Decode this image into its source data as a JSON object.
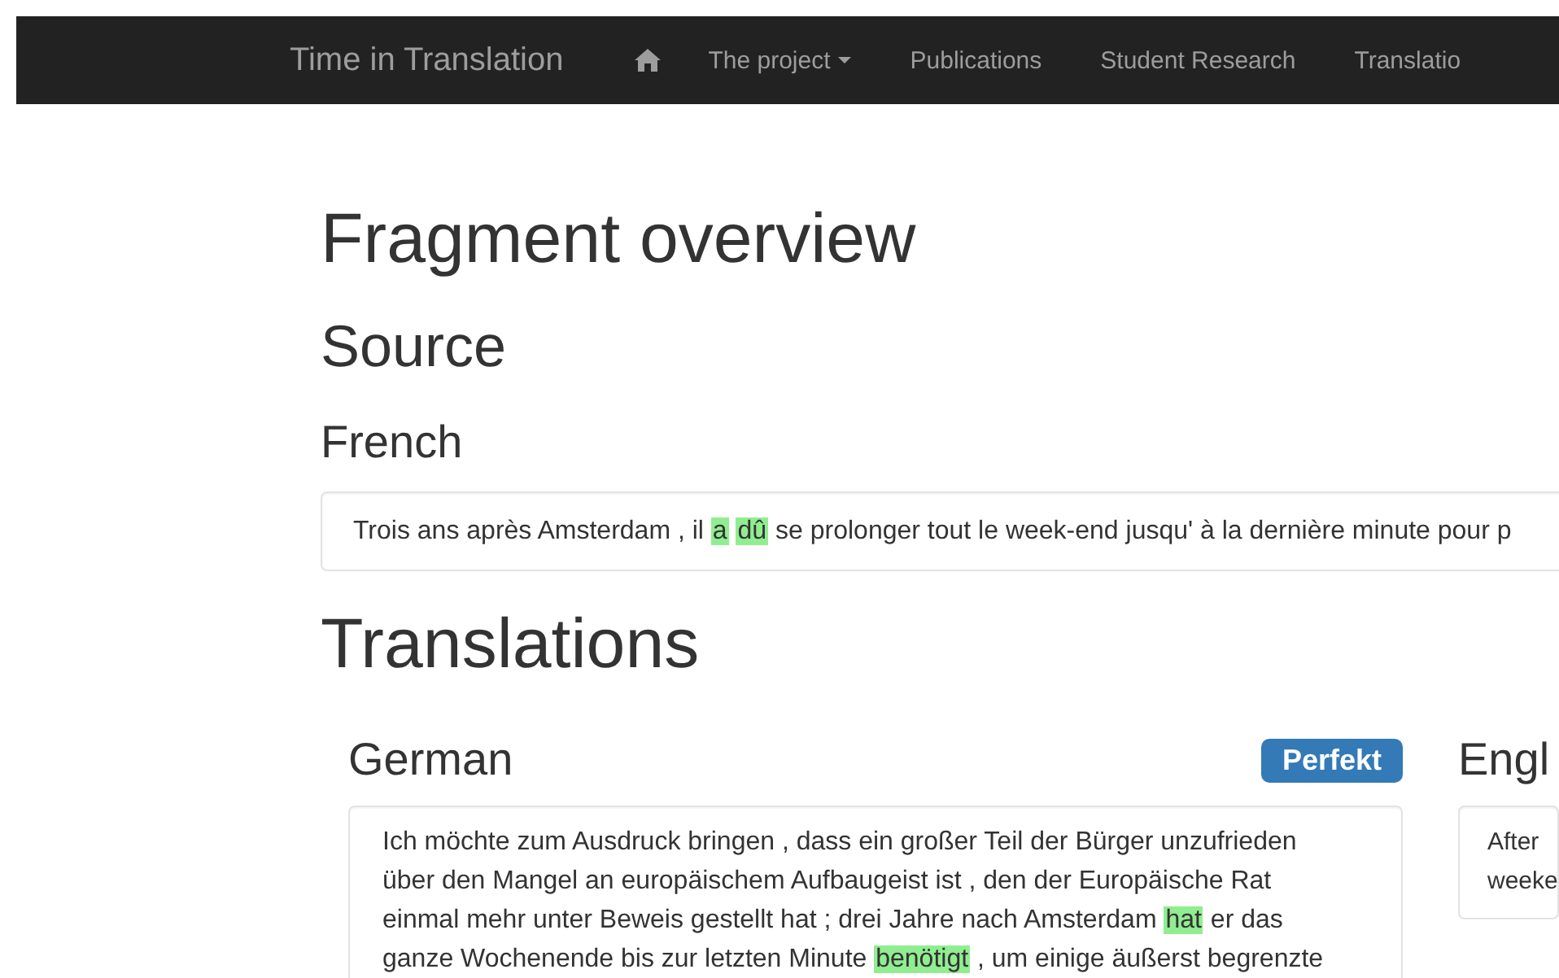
{
  "navbar": {
    "brand": "Time in Translation",
    "items": [
      {
        "label": "The project",
        "dropdown": true
      },
      {
        "label": "Publications",
        "dropdown": false
      },
      {
        "label": "Student Research",
        "dropdown": false
      },
      {
        "label": "Translatio",
        "dropdown": false
      }
    ]
  },
  "title": "Fragment overview",
  "source": {
    "heading": "Source",
    "language": "French",
    "segments": [
      {
        "text": "Trois ans après Amsterdam , il ",
        "highlighted": false
      },
      {
        "text": "a",
        "highlighted": true
      },
      {
        "text": "dû",
        "highlighted": true
      },
      {
        "text": " se prolonger tout le week-end jusqu' à la dernière minute pour p",
        "highlighted": false
      }
    ]
  },
  "translations": {
    "heading": "Translations",
    "panels": [
      {
        "language": "German",
        "tense": "Perfekt",
        "segments": [
          {
            "text": "Ich möchte zum Ausdruck bringen , dass ein großer Teil der Bürger unzufrieden über den Mangel an europäischem Aufbaugeist ist , den der Europäische Rat einmal mehr unter Beweis gestellt hat ; drei Jahre nach Amsterdam ",
            "highlighted": false
          },
          {
            "text": "hat",
            "highlighted": true
          },
          {
            "text": " er das ganze Wochenende bis zur letzten Minute ",
            "highlighted": false
          },
          {
            "text": "benötigt",
            "highlighted": true
          },
          {
            "text": " , um einige äußerst begrenzte",
            "highlighted": false
          }
        ]
      },
      {
        "language": "Engl",
        "segments": [
          {
            "text": "After weeke",
            "highlighted": false
          }
        ]
      }
    ]
  }
}
